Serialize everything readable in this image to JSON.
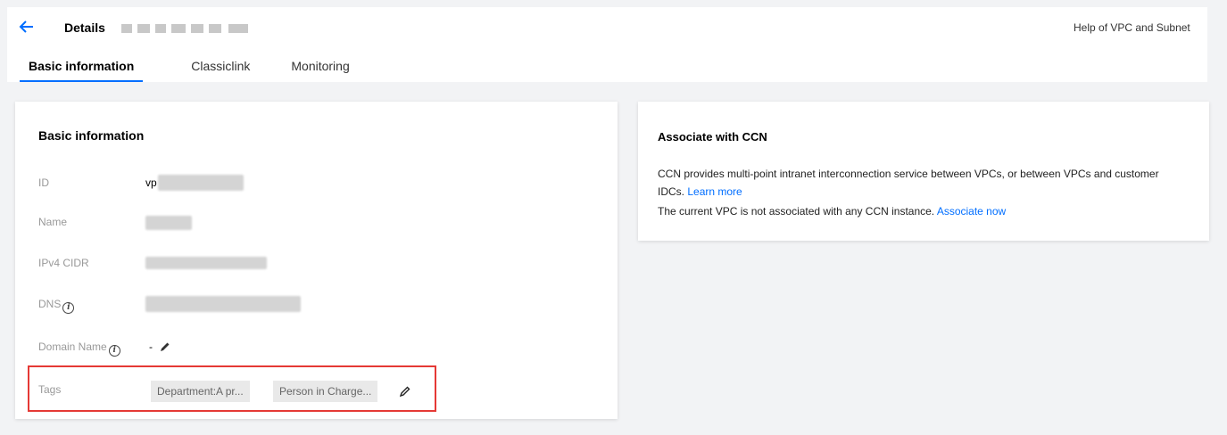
{
  "header": {
    "title": "Details",
    "help_link": "Help of VPC and Subnet"
  },
  "tabs": [
    {
      "label": "Basic information",
      "active": true
    },
    {
      "label": "Classiclink",
      "active": false
    },
    {
      "label": "Monitoring",
      "active": false
    }
  ],
  "basic_info": {
    "title": "Basic information",
    "id_label": "ID",
    "id_value": "vp",
    "name_label": "Name",
    "cidr_label": "IPv4 CIDR",
    "dns_label": "DNS",
    "domain_label": "Domain Name",
    "domain_value": "-",
    "tags_label": "Tags",
    "tags": [
      "Department:A pr...",
      "Person in Charge..."
    ]
  },
  "ccn": {
    "title": "Associate with CCN",
    "desc_line1": "CCN provides multi-point intranet interconnection service between VPCs, or between VPCs and customer",
    "desc_line2": "IDCs.",
    "learn_more": "Learn more",
    "status": "The current VPC is not associated with any CCN instance.",
    "associate_now": "Associate now"
  },
  "colors": {
    "accent": "#006eff",
    "highlight": "#e53935"
  }
}
